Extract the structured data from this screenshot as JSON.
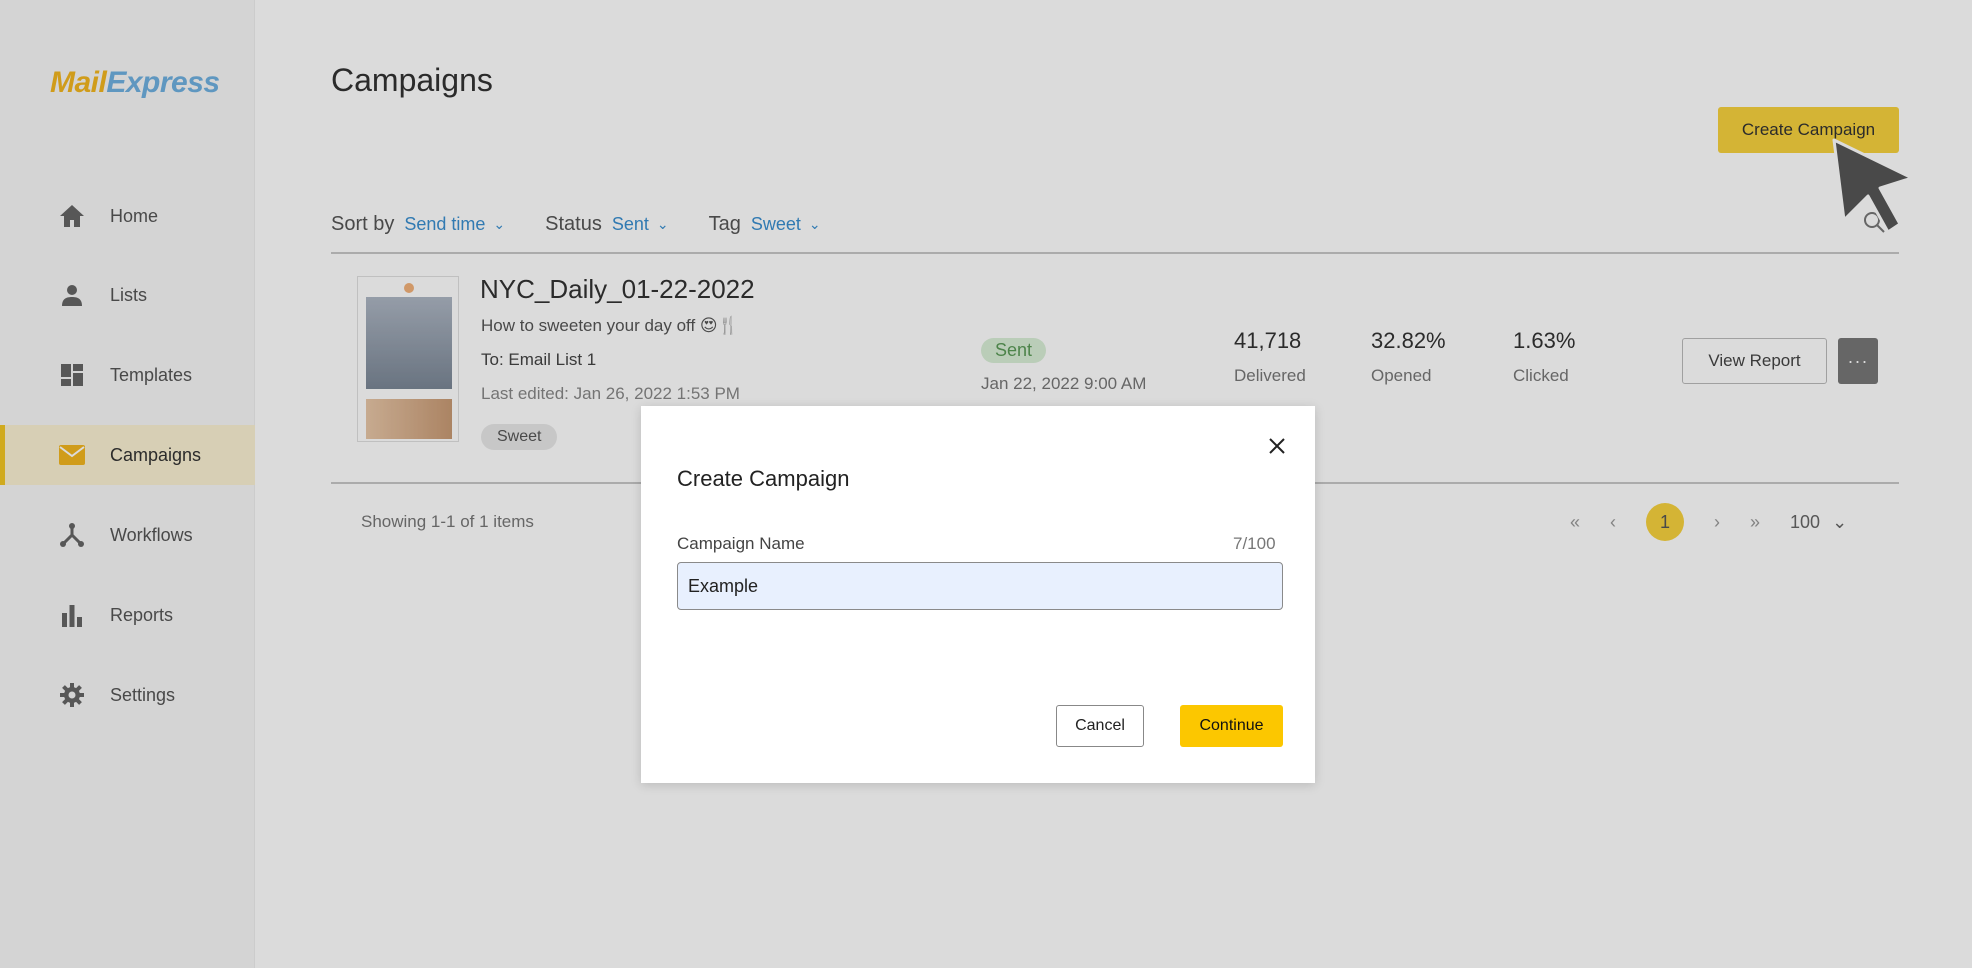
{
  "app": {
    "logo_part1": "Mail",
    "logo_part2": "Express"
  },
  "sidebar": {
    "items": [
      {
        "label": "Home",
        "icon": "home-icon"
      },
      {
        "label": "Lists",
        "icon": "user-icon"
      },
      {
        "label": "Templates",
        "icon": "templates-icon"
      },
      {
        "label": "Campaigns",
        "icon": "envelope-icon",
        "active": true
      },
      {
        "label": "Workflows",
        "icon": "workflow-icon"
      },
      {
        "label": "Reports",
        "icon": "bar-chart-icon"
      },
      {
        "label": "Settings",
        "icon": "gear-icon"
      }
    ]
  },
  "header": {
    "title": "Campaigns",
    "create_label": "Create Campaign"
  },
  "filters": {
    "sort_label": "Sort by",
    "sort_value": "Send time",
    "status_label": "Status",
    "status_value": "Sent",
    "tag_label": "Tag",
    "tag_value": "Sweet"
  },
  "campaign": {
    "name": "NYC_Daily_01-22-2022",
    "subject": "How to sweeten your day off 😍🍴",
    "to": "To: Email List 1",
    "last_edited": "Last edited: Jan 26, 2022 1:53 PM",
    "tag": "Sweet",
    "status": "Sent",
    "sent_date": "Jan 22, 2022 9:00 AM",
    "delivered_value": "41,718",
    "delivered_label": "Delivered",
    "opened_value": "32.82%",
    "opened_label": "Opened",
    "clicked_value": "1.63%",
    "clicked_label": "Clicked",
    "view_report_label": "View Report",
    "more_label": "···"
  },
  "footer": {
    "showing": "Showing 1-1 of 1 items",
    "first": "«",
    "prev": "‹",
    "page": "1",
    "next": "›",
    "last": "»",
    "page_size": "100"
  },
  "modal": {
    "title": "Create Campaign",
    "field_label": "Campaign Name",
    "char_count": "7/100",
    "input_value": "Example",
    "cancel_label": "Cancel",
    "continue_label": "Continue"
  },
  "colors": {
    "accent": "#fcc700",
    "link": "#3a8fd0",
    "status_sent_bg": "#d9efd7"
  }
}
